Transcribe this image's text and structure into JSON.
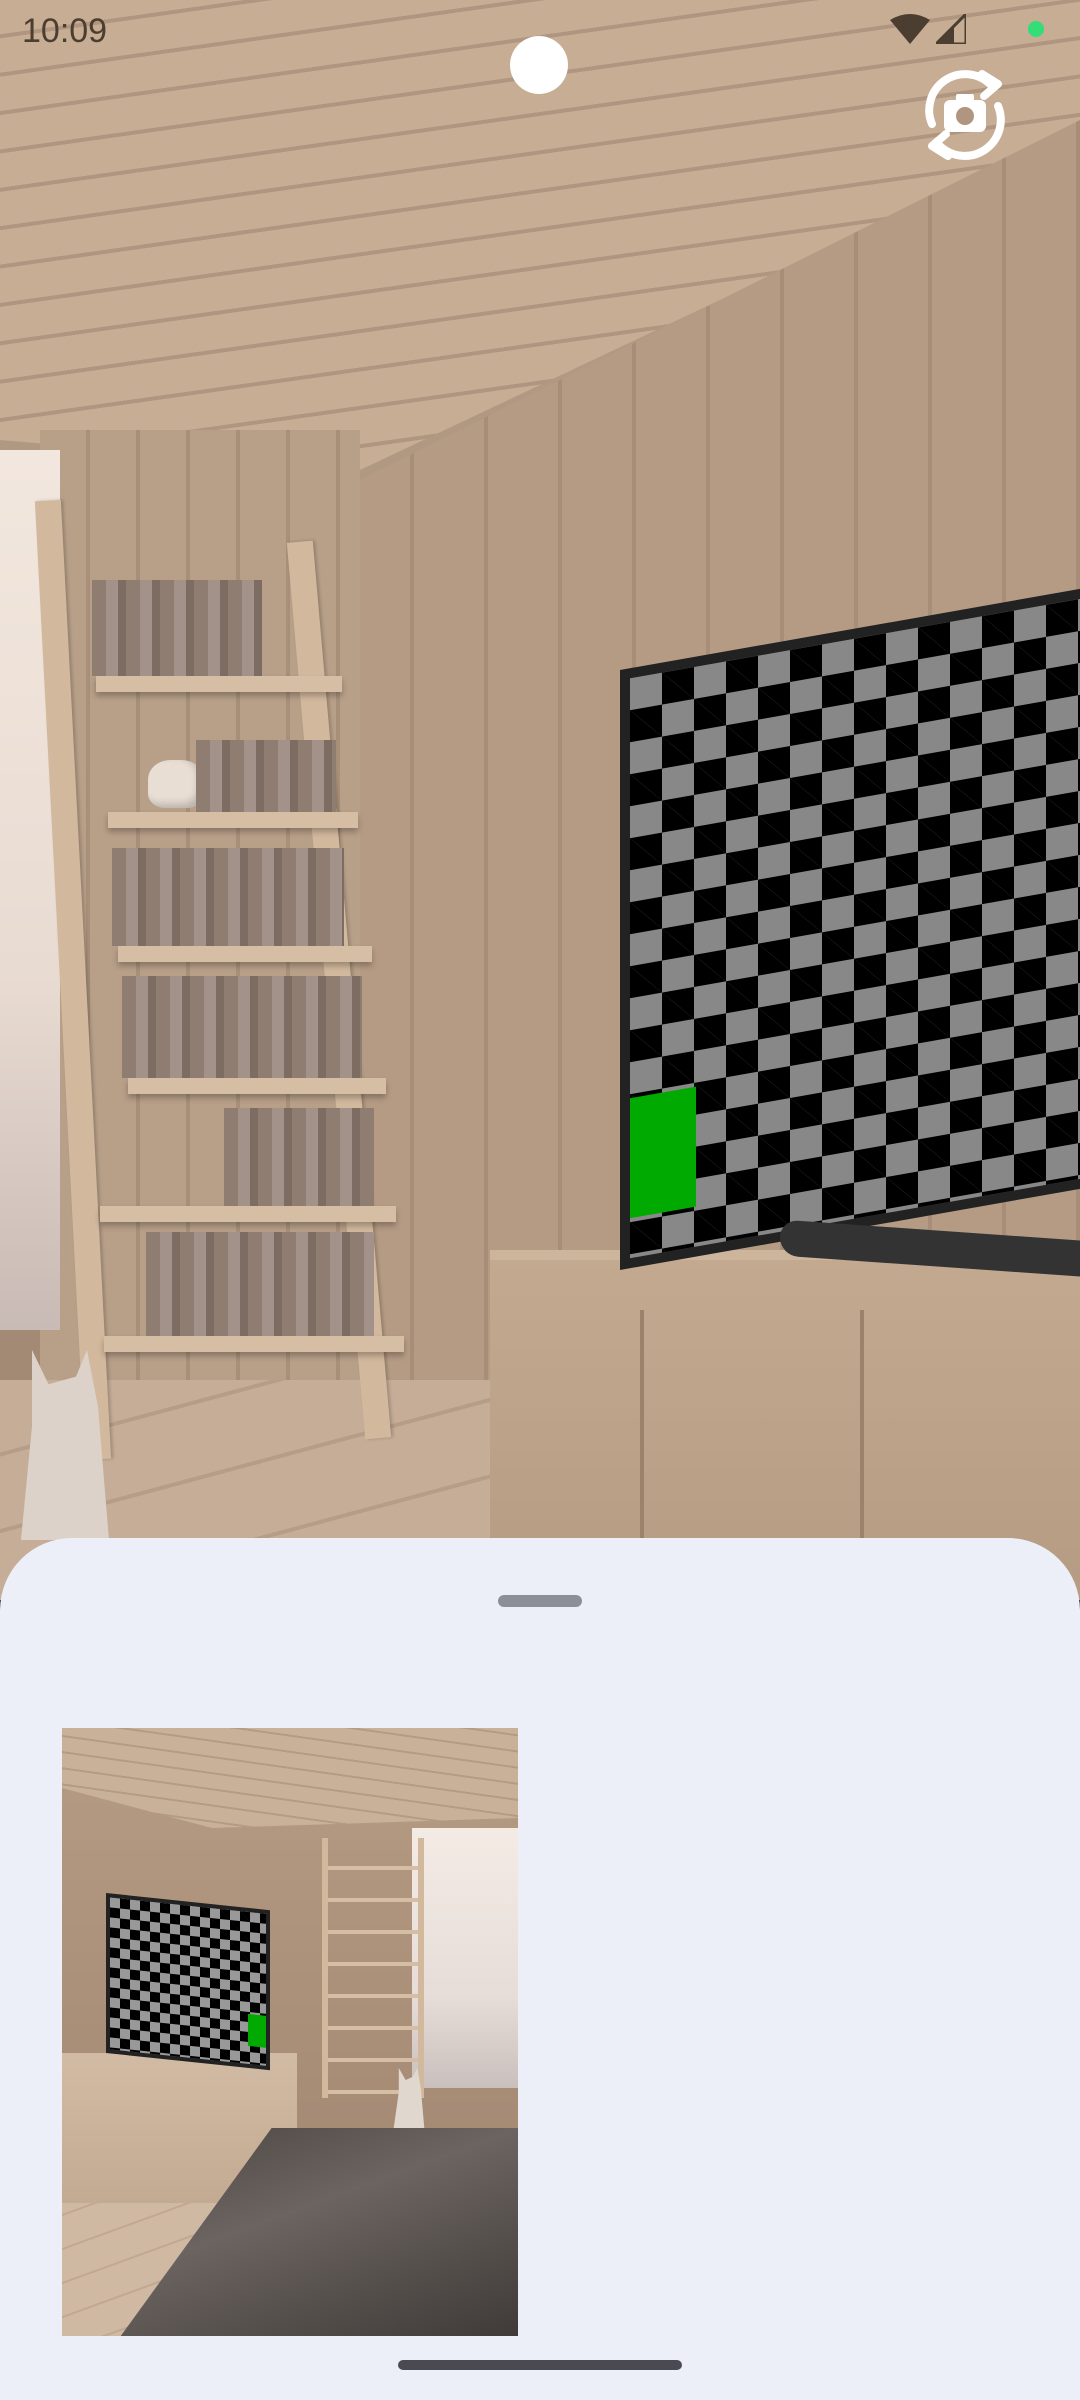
{
  "status_bar": {
    "time": "10:09",
    "icons": [
      "wifi-icon",
      "signal-icon",
      "privacy-indicator-dot"
    ]
  },
  "camera": {
    "controls": [
      "switch-camera-icon"
    ]
  },
  "bottom_sheet": {
    "handle": "drag-handle",
    "thumbnail": "captured-photo-thumbnail"
  },
  "colors": {
    "sheet_background": "#eceef8",
    "privacy_dot": "#33dd77",
    "handle": "#8d8f98",
    "gesture_bar": "#4a4b52"
  }
}
